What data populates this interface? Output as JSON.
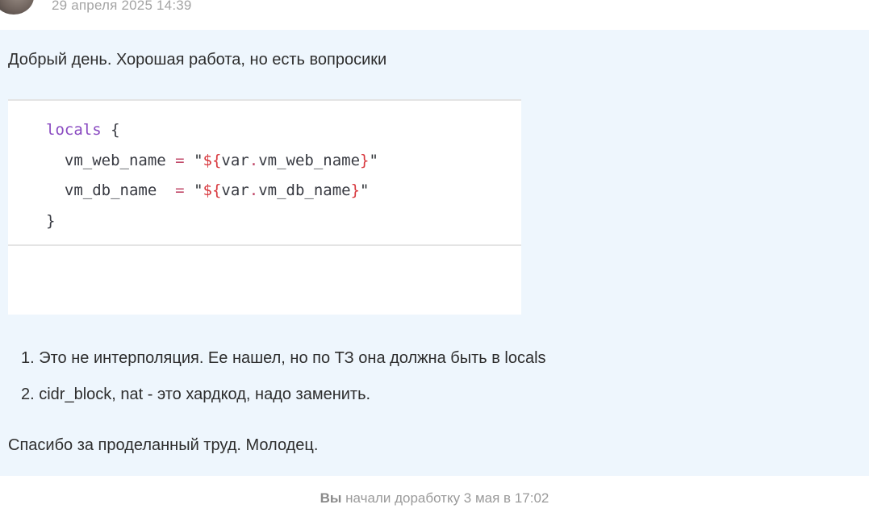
{
  "header": {
    "timestamp": "29 апреля 2025 14:39",
    "avatar_icon": "user-avatar"
  },
  "message": {
    "greeting": "Добрый день. Хорошая работа, но есть вопросики",
    "code": {
      "language": "hcl",
      "lines": [
        "locals {",
        "  vm_web_name = \"${var.vm_web_name}\"",
        "  vm_db_name  = \"${var.vm_db_name}\"",
        "}"
      ]
    },
    "list": [
      "1. Это не интерполяция. Ее нашел, но по ТЗ она должна быть в locals",
      "2. cidr_block, nat - это хардкод, надо заменить."
    ],
    "thanks": "Спасибо за проделанный труд. Молодец."
  },
  "footer": {
    "who": "Вы",
    "text": " начали доработку 3 мая в 17:02"
  },
  "colors": {
    "message_bg": "#eef6fd",
    "keyword": "#8a4bc1",
    "interpolation": "#d8393f",
    "muted_text": "#a4a4a4"
  }
}
